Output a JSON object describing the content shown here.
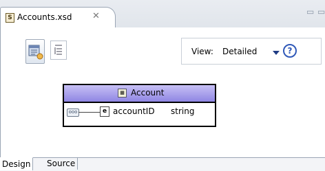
{
  "editor_tab": {
    "title": "Accounts.xsd",
    "icon": "xsd-schema-file-icon",
    "close_icon": "close-tab-icon",
    "file_glyph": "S"
  },
  "window_controls": {
    "minimize": "▭",
    "maximize": "▭"
  },
  "toolbar": {
    "show_schema_icon": "schema-view-icon",
    "outline_icon": "outline-view-icon"
  },
  "view_control": {
    "label": "View:",
    "selected": "Detailed",
    "help": "?"
  },
  "diagram": {
    "complex_type": {
      "name": "Account",
      "icon": "complex-type-icon"
    },
    "sequence_icon": "sequence-icon",
    "sequence_glyph": "ooo",
    "element_glyph": "e",
    "element": {
      "name": "accountID",
      "type": "string"
    }
  },
  "bottom_tabs": [
    {
      "label": "Design",
      "active": true
    },
    {
      "label": "Source",
      "active": false
    }
  ],
  "colors": {
    "header_start": "#c7c0f5",
    "header_end": "#8f86e3",
    "help_blue": "#2f58b8"
  }
}
